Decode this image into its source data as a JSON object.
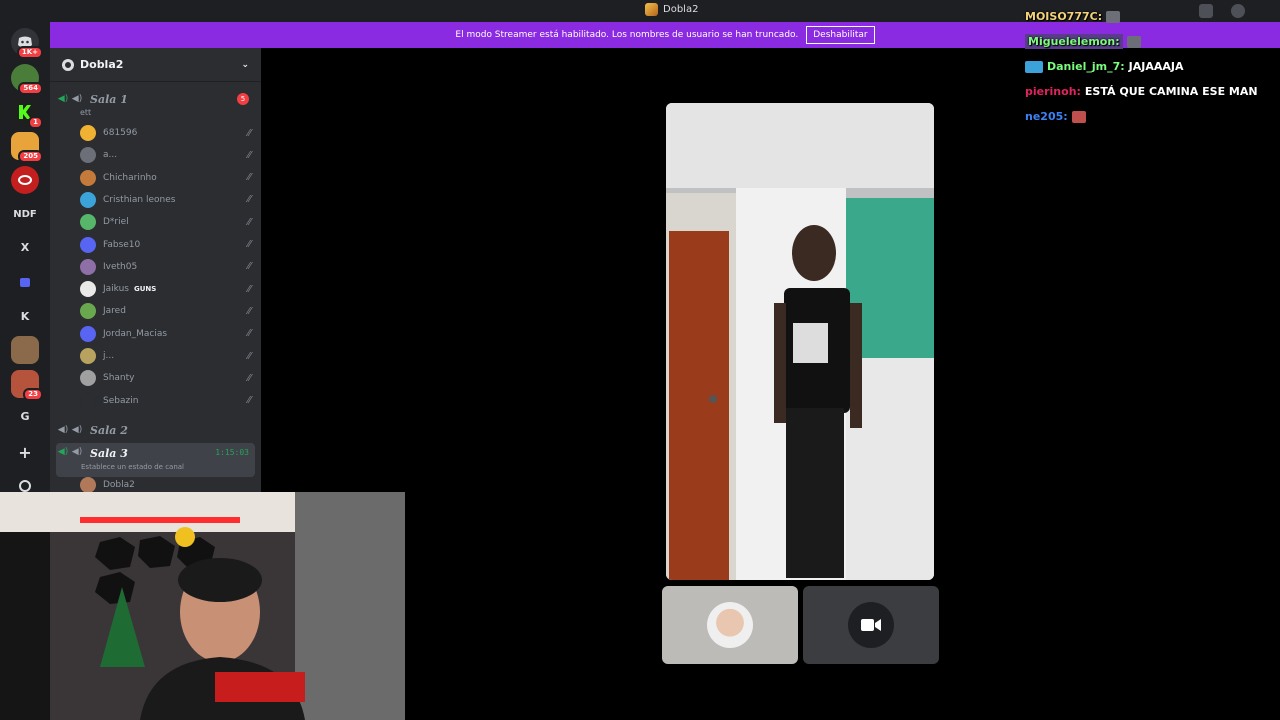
{
  "titlebar": {
    "title": "Dobla2"
  },
  "banner": {
    "text": "El modo Streamer está habilitado. Los nombres de usuario se han truncado.",
    "button": "Deshabilitar"
  },
  "rail": {
    "items": [
      {
        "label": "",
        "badge": "1K+"
      },
      {
        "label": "",
        "badge": "564"
      },
      {
        "label": "",
        "badge": "1"
      },
      {
        "label": "",
        "badge": "205"
      },
      {
        "label": "",
        "badge": ""
      },
      {
        "label": "NDF",
        "badge": ""
      },
      {
        "label": "X",
        "badge": ""
      },
      {
        "label": "",
        "badge": ""
      },
      {
        "label": "K",
        "badge": ""
      },
      {
        "label": "",
        "badge": ""
      },
      {
        "label": "",
        "badge": "23"
      },
      {
        "label": "G",
        "badge": ""
      },
      {
        "label": "+",
        "badge": ""
      },
      {
        "label": "",
        "badge": ""
      }
    ]
  },
  "server": {
    "name": "Dobla2"
  },
  "channels": {
    "sala1": {
      "name": "Sala 1",
      "mention": "5",
      "status": "ett"
    },
    "sala2": {
      "name": "Sala 2"
    },
    "sala3": {
      "name": "Sala 3",
      "timer": "1:15:03",
      "status": "Establece un estado de canal"
    }
  },
  "sala1_users": [
    {
      "name": "681596",
      "color": "#f0b232",
      "tag": ""
    },
    {
      "name": "a...",
      "color": "#6d6f78",
      "tag": ""
    },
    {
      "name": "Chicharinho",
      "color": "#c47a3a",
      "tag": ""
    },
    {
      "name": "Cristhian leones",
      "color": "#3ba3d9",
      "tag": ""
    },
    {
      "name": "D*riel",
      "color": "#57b66a",
      "tag": ""
    },
    {
      "name": "Fabse10",
      "color": "#5865f2",
      "tag": ""
    },
    {
      "name": "Iveth05",
      "color": "#8e6fa8",
      "tag": ""
    },
    {
      "name": "Jaikus",
      "color": "#e9e9e9",
      "tag": "GUNS"
    },
    {
      "name": "Jared",
      "color": "#6aa84f",
      "tag": ""
    },
    {
      "name": "Jordan_Macias",
      "color": "#5865f2",
      "tag": ""
    },
    {
      "name": "j...",
      "color": "#b8a25f",
      "tag": ""
    },
    {
      "name": "Shanty",
      "color": "#a0a0a0",
      "tag": ""
    },
    {
      "name": "Sebazin",
      "color": "#2b2d31",
      "tag": ""
    }
  ],
  "sala3_users": [
    {
      "name": "Dobla2",
      "color": "#b07a5a"
    }
  ],
  "chat": [
    {
      "nick": "MOISO777C:",
      "nick_color": "#f3d27a",
      "text": ""
    },
    {
      "nick": "Miguelelemon:",
      "nick_color": "#7cfc7c",
      "text": ""
    },
    {
      "nick": "Daniel_jm_7:",
      "nick_color": "#7cfc7c",
      "text": "JAJAAAJA"
    },
    {
      "nick": "pierinoh:",
      "nick_color": "#e0245e",
      "text": "ESTÁ QUE CAMINA ESE MAN"
    },
    {
      "nick": "ne205:",
      "nick_color": "#3b82f6",
      "text": ""
    }
  ]
}
